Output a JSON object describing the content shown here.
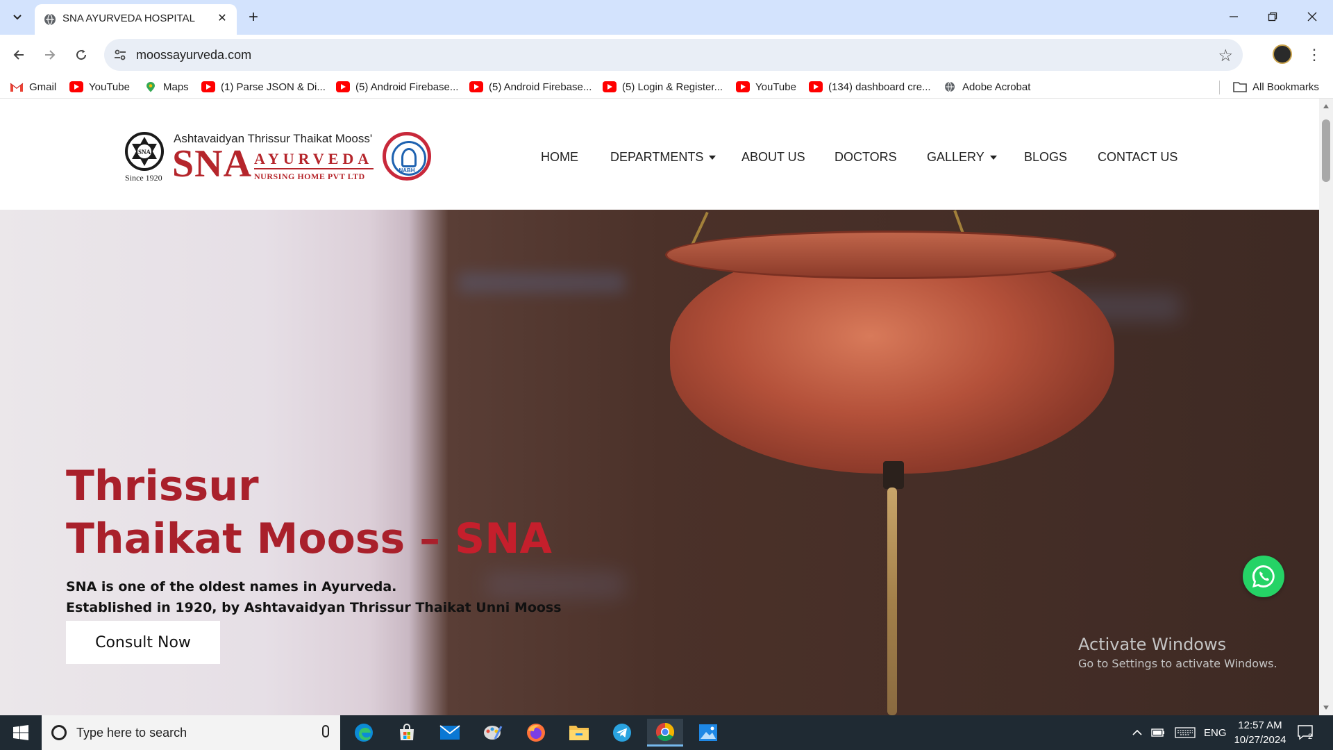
{
  "browser": {
    "tab_title": "SNA AYURVEDA HOSPITAL",
    "url": "moossayurveda.com",
    "bookmarks": [
      {
        "label": "Gmail",
        "icon": "gmail-icon"
      },
      {
        "label": "YouTube",
        "icon": "youtube-icon"
      },
      {
        "label": "Maps",
        "icon": "maps-icon"
      },
      {
        "label": "(1) Parse JSON & Di...",
        "icon": "youtube-icon"
      },
      {
        "label": "(5) Android Firebase...",
        "icon": "youtube-icon"
      },
      {
        "label": "(5) Android Firebase...",
        "icon": "youtube-icon"
      },
      {
        "label": "(5) Login & Register...",
        "icon": "youtube-icon"
      },
      {
        "label": "YouTube",
        "icon": "youtube-icon"
      },
      {
        "label": "(134) dashboard cre...",
        "icon": "youtube-icon"
      },
      {
        "label": "Adobe Acrobat",
        "icon": "globe-icon"
      }
    ],
    "all_bookmarks": "All Bookmarks"
  },
  "site": {
    "logo": {
      "top_line": "Ashtavaidyan Thrissur Thaikat Mooss'",
      "sna": "SNA",
      "ayurveda": "AYURVEDA",
      "nursing": "NURSING HOME PVT LTD",
      "since": "Since 1920",
      "badge": "NABH"
    },
    "nav": {
      "home": "HOME",
      "departments": "DEPARTMENTS",
      "about": "ABOUT US",
      "doctors": "DOCTORS",
      "gallery": "GALLERY",
      "blogs": "BLOGS",
      "contact": "CONTACT US"
    },
    "hero": {
      "title_line1": "Thrissur",
      "title_line2": "Thaikat Mooss – ",
      "title_highlight": "SNA",
      "subtitle_line1": "SNA is one of the oldest names in Ayurveda.",
      "subtitle_line2": "Established in 1920, by Ashtavaidyan Thrissur Thaikat Unni Mooss",
      "cta": "Consult Now"
    }
  },
  "watermark": {
    "line1": "Activate Windows",
    "line2": "Go to Settings to activate Windows."
  },
  "taskbar": {
    "search_placeholder": "Type here to search",
    "lang": "ENG",
    "time": "12:57 AM",
    "date": "10/27/2024",
    "notifications": "2"
  },
  "colors": {
    "brand_red": "#b5252b",
    "tab_strip": "#d3e3fd",
    "whatsapp": "#25d366"
  }
}
